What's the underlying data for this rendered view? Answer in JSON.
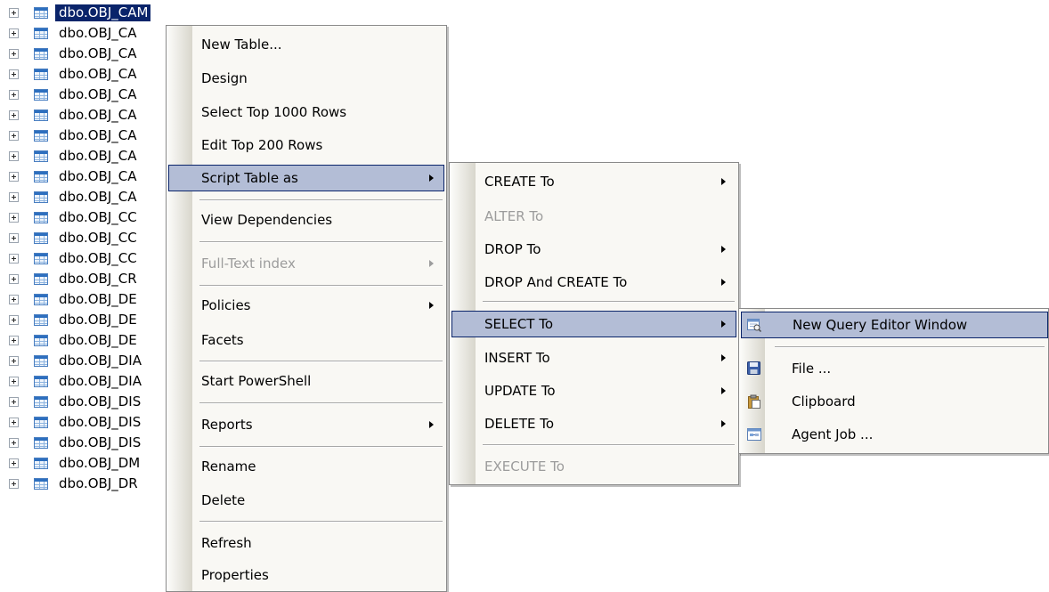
{
  "tree": {
    "items": [
      "dbo.OBJ_CAM",
      "dbo.OBJ_CA",
      "dbo.OBJ_CA",
      "dbo.OBJ_CA",
      "dbo.OBJ_CA",
      "dbo.OBJ_CA",
      "dbo.OBJ_CA",
      "dbo.OBJ_CA",
      "dbo.OBJ_CA",
      "dbo.OBJ_CA",
      "dbo.OBJ_CC",
      "dbo.OBJ_CC",
      "dbo.OBJ_CC",
      "dbo.OBJ_CR",
      "dbo.OBJ_DE",
      "dbo.OBJ_DE",
      "dbo.OBJ_DE",
      "dbo.OBJ_DIA",
      "dbo.OBJ_DIA",
      "dbo.OBJ_DIS",
      "dbo.OBJ_DIS",
      "dbo.OBJ_DIS",
      "dbo.OBJ_DM",
      "dbo.OBJ_DR"
    ]
  },
  "context_menu": {
    "new_table": "New Table...",
    "design": "Design",
    "select_top": "Select Top 1000 Rows",
    "edit_top": "Edit Top 200 Rows",
    "script_table_as": "Script Table as",
    "view_dependencies": "View Dependencies",
    "full_text_index": "Full-Text index",
    "policies": "Policies",
    "facets": "Facets",
    "start_powershell": "Start PowerShell",
    "reports": "Reports",
    "rename": "Rename",
    "delete": "Delete",
    "refresh": "Refresh",
    "properties": "Properties"
  },
  "script_submenu": {
    "create_to": "CREATE To",
    "alter_to": "ALTER To",
    "drop_to": "DROP To",
    "drop_and_create_to": "DROP And CREATE To",
    "select_to": "SELECT To",
    "insert_to": "INSERT To",
    "update_to": "UPDATE To",
    "delete_to": "DELETE To",
    "execute_to": "EXECUTE To"
  },
  "select_submenu": {
    "new_query_editor_window": "New Query Editor Window",
    "file": "File ...",
    "clipboard": "Clipboard",
    "agent_job": "Agent Job ..."
  },
  "colors": {
    "selection": "#0a246a",
    "menu_highlight": "#b3bdd6",
    "menu_background": "#f9f8f4",
    "disabled_text": "#9c9c9c"
  }
}
